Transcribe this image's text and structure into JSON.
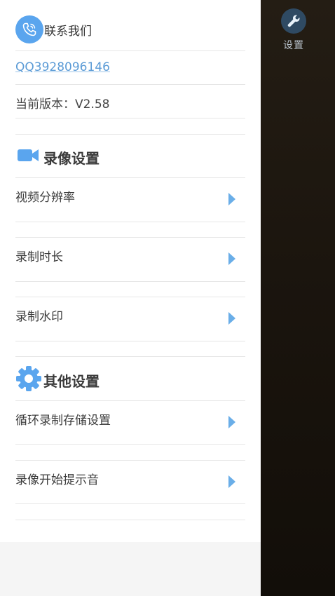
{
  "contact": {
    "title": "联系我们",
    "qq": "QQ3928096146",
    "version": "当前版本：V2.58"
  },
  "video_settings": {
    "title": "录像设置",
    "items": [
      {
        "label": "视频分辨率"
      },
      {
        "label": "录制时长"
      },
      {
        "label": "录制水印"
      }
    ]
  },
  "other_settings": {
    "title": "其他设置",
    "items": [
      {
        "label": "循环录制存储设置"
      },
      {
        "label": "录像开始提示音"
      }
    ]
  },
  "side": {
    "settings_label": "设置"
  },
  "icons": {
    "contact": "phone-icon",
    "video": "video-camera-icon",
    "other": "gear-icon",
    "row": "chevron-right-icon",
    "side": "wrench-icon"
  },
  "colors": {
    "accent": "#5aa5ee",
    "link": "#5b9bd6",
    "arrow": "#6aaee8",
    "panel_dark": "#1b150e"
  }
}
